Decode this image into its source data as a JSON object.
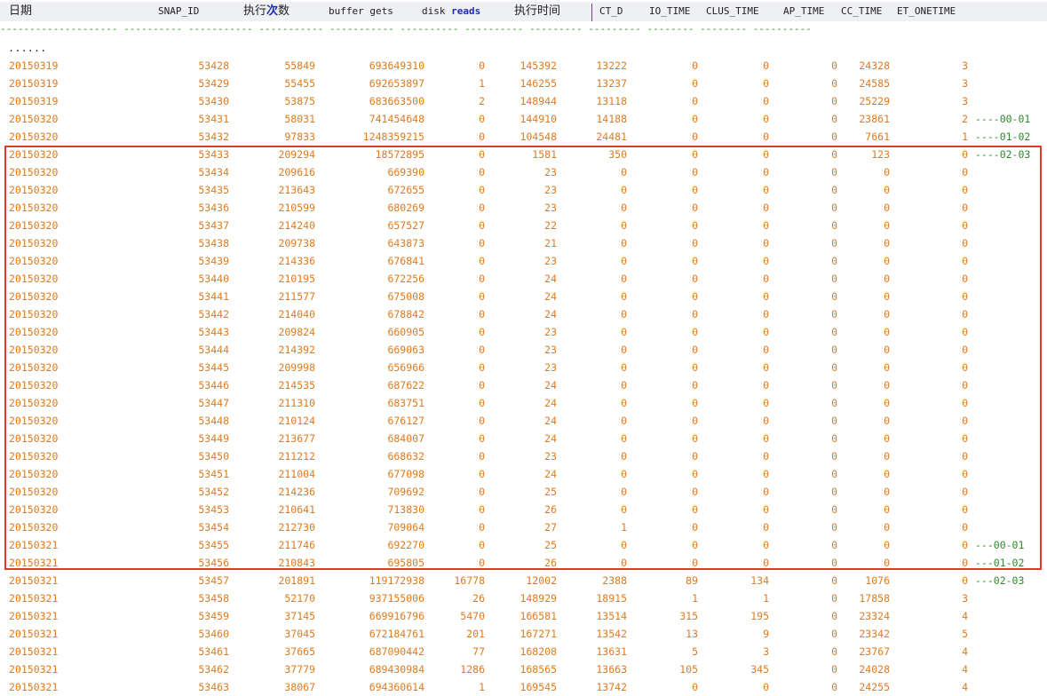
{
  "headers": {
    "date": "日期",
    "snap_id": "SNAP_ID",
    "exec_count_a": "执行",
    "exec_count_b": "次",
    "exec_count_c": "数",
    "buffer_gets": "buffer gets",
    "disk_reads_a": "disk",
    "disk_reads_b": "reads",
    "exec_time": "执行时间",
    "ct_d": "CT_D",
    "io_time": "IO_TIME",
    "clus_time": "CLUS_TIME",
    "ap_time": "AP_TIME",
    "cc_time": "CC_TIME",
    "et_onetime": "ET_ONETIME"
  },
  "separator": "-------------------- ---------- ----------- ----------- ----------- ---------- ---------- --------- --------- -------- -------- ----------",
  "ellipsis": "......",
  "rows": [
    [
      "20150319",
      "53428",
      "55849",
      "693649310",
      "0",
      "145392",
      "13222",
      "0",
      "0",
      "0",
      "24328",
      "3",
      ""
    ],
    [
      "20150319",
      "53429",
      "55455",
      "692653897",
      "1",
      "146255",
      "13237",
      "0",
      "0",
      "0",
      "24585",
      "3",
      ""
    ],
    [
      "20150319",
      "53430",
      "53875",
      "683663500",
      "2",
      "148944",
      "13118",
      "0",
      "0",
      "0",
      "25229",
      "3",
      ""
    ],
    [
      "20150320",
      "53431",
      "58031",
      "741454648",
      "0",
      "144910",
      "14188",
      "0",
      "0",
      "0",
      "23861",
      "2",
      "----00-01"
    ],
    [
      "20150320",
      "53432",
      "97833",
      "1248359215",
      "0",
      "104548",
      "24481",
      "0",
      "0",
      "0",
      "7661",
      "1",
      "----01-02"
    ],
    [
      "20150320",
      "53433",
      "209294",
      "18572895",
      "0",
      "1581",
      "350",
      "0",
      "0",
      "0",
      "123",
      "0",
      "----02-03"
    ],
    [
      "20150320",
      "53434",
      "209616",
      "669390",
      "0",
      "23",
      "0",
      "0",
      "0",
      "0",
      "0",
      "0",
      ""
    ],
    [
      "20150320",
      "53435",
      "213643",
      "672655",
      "0",
      "23",
      "0",
      "0",
      "0",
      "0",
      "0",
      "0",
      ""
    ],
    [
      "20150320",
      "53436",
      "210599",
      "680269",
      "0",
      "23",
      "0",
      "0",
      "0",
      "0",
      "0",
      "0",
      ""
    ],
    [
      "20150320",
      "53437",
      "214240",
      "657527",
      "0",
      "22",
      "0",
      "0",
      "0",
      "0",
      "0",
      "0",
      ""
    ],
    [
      "20150320",
      "53438",
      "209738",
      "643873",
      "0",
      "21",
      "0",
      "0",
      "0",
      "0",
      "0",
      "0",
      ""
    ],
    [
      "20150320",
      "53439",
      "214336",
      "676841",
      "0",
      "23",
      "0",
      "0",
      "0",
      "0",
      "0",
      "0",
      ""
    ],
    [
      "20150320",
      "53440",
      "210195",
      "672256",
      "0",
      "24",
      "0",
      "0",
      "0",
      "0",
      "0",
      "0",
      ""
    ],
    [
      "20150320",
      "53441",
      "211577",
      "675008",
      "0",
      "24",
      "0",
      "0",
      "0",
      "0",
      "0",
      "0",
      ""
    ],
    [
      "20150320",
      "53442",
      "214040",
      "678842",
      "0",
      "24",
      "0",
      "0",
      "0",
      "0",
      "0",
      "0",
      ""
    ],
    [
      "20150320",
      "53443",
      "209824",
      "660905",
      "0",
      "23",
      "0",
      "0",
      "0",
      "0",
      "0",
      "0",
      ""
    ],
    [
      "20150320",
      "53444",
      "214392",
      "669063",
      "0",
      "23",
      "0",
      "0",
      "0",
      "0",
      "0",
      "0",
      ""
    ],
    [
      "20150320",
      "53445",
      "209998",
      "656966",
      "0",
      "23",
      "0",
      "0",
      "0",
      "0",
      "0",
      "0",
      ""
    ],
    [
      "20150320",
      "53446",
      "214535",
      "687622",
      "0",
      "24",
      "0",
      "0",
      "0",
      "0",
      "0",
      "0",
      ""
    ],
    [
      "20150320",
      "53447",
      "211310",
      "683751",
      "0",
      "24",
      "0",
      "0",
      "0",
      "0",
      "0",
      "0",
      ""
    ],
    [
      "20150320",
      "53448",
      "210124",
      "676127",
      "0",
      "24",
      "0",
      "0",
      "0",
      "0",
      "0",
      "0",
      ""
    ],
    [
      "20150320",
      "53449",
      "213677",
      "684007",
      "0",
      "24",
      "0",
      "0",
      "0",
      "0",
      "0",
      "0",
      ""
    ],
    [
      "20150320",
      "53450",
      "211212",
      "668632",
      "0",
      "23",
      "0",
      "0",
      "0",
      "0",
      "0",
      "0",
      ""
    ],
    [
      "20150320",
      "53451",
      "211004",
      "677098",
      "0",
      "24",
      "0",
      "0",
      "0",
      "0",
      "0",
      "0",
      ""
    ],
    [
      "20150320",
      "53452",
      "214236",
      "709692",
      "0",
      "25",
      "0",
      "0",
      "0",
      "0",
      "0",
      "0",
      ""
    ],
    [
      "20150320",
      "53453",
      "210641",
      "713830",
      "0",
      "26",
      "0",
      "0",
      "0",
      "0",
      "0",
      "0",
      ""
    ],
    [
      "20150320",
      "53454",
      "212730",
      "709064",
      "0",
      "27",
      "1",
      "0",
      "0",
      "0",
      "0",
      "0",
      ""
    ],
    [
      "20150321",
      "53455",
      "211746",
      "692270",
      "0",
      "25",
      "0",
      "0",
      "0",
      "0",
      "0",
      "0",
      "---00-01"
    ],
    [
      "20150321",
      "53456",
      "210843",
      "695805",
      "0",
      "26",
      "0",
      "0",
      "0",
      "0",
      "0",
      "0",
      "---01-02"
    ],
    [
      "20150321",
      "53457",
      "201891",
      "119172938",
      "16778",
      "12002",
      "2388",
      "89",
      "134",
      "0",
      "1076",
      "0",
      "---02-03"
    ],
    [
      "20150321",
      "53458",
      "52170",
      "937155006",
      "26",
      "148929",
      "18915",
      "1",
      "1",
      "0",
      "17858",
      "3",
      ""
    ],
    [
      "20150321",
      "53459",
      "37145",
      "669916796",
      "5470",
      "166581",
      "13514",
      "315",
      "195",
      "0",
      "23324",
      "4",
      ""
    ],
    [
      "20150321",
      "53460",
      "37045",
      "672184761",
      "201",
      "167271",
      "13542",
      "13",
      "9",
      "0",
      "23342",
      "5",
      ""
    ],
    [
      "20150321",
      "53461",
      "37665",
      "687090442",
      "77",
      "168208",
      "13631",
      "5",
      "3",
      "0",
      "23767",
      "4",
      ""
    ],
    [
      "20150321",
      "53462",
      "37779",
      "689430984",
      "1286",
      "168565",
      "13663",
      "105",
      "345",
      "0",
      "24028",
      "4",
      ""
    ],
    [
      "20150321",
      "53463",
      "38067",
      "694360614",
      "1",
      "169545",
      "13742",
      "0",
      "0",
      "0",
      "24255",
      "4",
      ""
    ]
  ]
}
